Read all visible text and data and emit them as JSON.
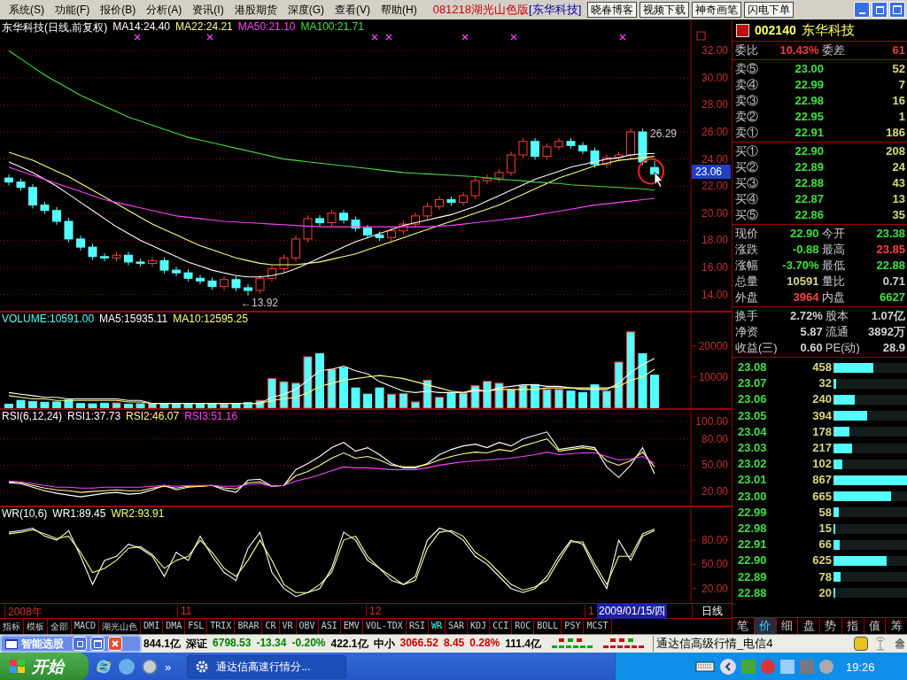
{
  "menu": {
    "items": [
      "系统(S)",
      "功能(F)",
      "报价(B)",
      "分析(A)",
      "资讯(I)",
      "港股期货",
      "深度(G)",
      "查看(V)",
      "帮助(H)"
    ],
    "version": "081218湖光山色版",
    "stock": "[东华科技]",
    "buttons": [
      "晓春博客",
      "视频下载",
      "神奇画笔",
      "闪电下单"
    ]
  },
  "price_panel": {
    "title": "东华科技(日线,前复权)",
    "high_label": "26.29",
    "low_label": "←13.92",
    "cursor_label": "23.06",
    "chart_data": {
      "type": "candlestick",
      "ylim": [
        12.8,
        34.3
      ],
      "grid": true,
      "yticks": [
        {
          "value": 32,
          "label": "32.00"
        },
        {
          "value": 30,
          "label": "30.00"
        },
        {
          "value": 28,
          "label": "28.00"
        },
        {
          "value": 26,
          "label": "26.00"
        },
        {
          "value": 24,
          "label": "24.00"
        },
        {
          "value": 22,
          "label": "22.00"
        },
        {
          "value": 20,
          "label": "20.00"
        },
        {
          "value": 18,
          "label": "18.00"
        },
        {
          "value": 16,
          "label": "16.00"
        },
        {
          "value": 14,
          "label": "14.00"
        }
      ],
      "ohlc": [
        [
          22.6,
          22.85,
          22.05,
          22.3
        ],
        [
          22.3,
          22.55,
          21.65,
          21.9
        ],
        [
          21.9,
          22.15,
          20.35,
          20.6
        ],
        [
          20.6,
          20.85,
          19.95,
          20.2
        ],
        [
          20.2,
          20.45,
          19.15,
          19.4
        ],
        [
          19.4,
          19.65,
          17.85,
          18.1
        ],
        [
          18.1,
          18.35,
          17.25,
          17.5
        ],
        [
          17.5,
          17.75,
          16.55,
          16.8
        ],
        [
          16.8,
          17.05,
          16.45,
          16.7
        ],
        [
          16.7,
          17.15,
          16.45,
          16.9
        ],
        [
          16.9,
          17.15,
          16.15,
          16.4
        ],
        [
          16.4,
          16.65,
          16.05,
          16.3
        ],
        [
          16.3,
          16.75,
          16.05,
          16.5
        ],
        [
          16.5,
          16.75,
          15.55,
          15.8
        ],
        [
          15.8,
          16.05,
          15.35,
          15.6
        ],
        [
          15.6,
          15.85,
          14.95,
          15.2
        ],
        [
          15.2,
          15.45,
          14.75,
          15.0
        ],
        [
          15.0,
          15.25,
          14.35,
          14.6
        ],
        [
          14.6,
          15.35,
          14.35,
          15.1
        ],
        [
          15.1,
          15.35,
          14.25,
          14.5
        ],
        [
          14.5,
          14.75,
          13.92,
          14.3
        ],
        [
          14.3,
          15.45,
          14.05,
          15.2
        ],
        [
          15.2,
          16.15,
          14.95,
          15.9
        ],
        [
          15.9,
          16.95,
          15.65,
          16.7
        ],
        [
          16.7,
          18.35,
          16.45,
          18.1
        ],
        [
          18.1,
          19.85,
          17.85,
          19.6
        ],
        [
          19.6,
          19.85,
          19.05,
          19.3
        ],
        [
          19.3,
          20.25,
          19.05,
          20.0
        ],
        [
          20.0,
          20.25,
          19.25,
          19.5
        ],
        [
          19.5,
          19.75,
          18.65,
          18.9
        ],
        [
          18.9,
          19.15,
          18.15,
          18.4
        ],
        [
          18.4,
          18.65,
          17.95,
          18.2
        ],
        [
          18.2,
          18.95,
          17.95,
          18.7
        ],
        [
          18.7,
          19.45,
          18.45,
          19.2
        ],
        [
          19.2,
          20.05,
          18.95,
          19.8
        ],
        [
          19.8,
          20.75,
          19.55,
          20.5
        ],
        [
          20.5,
          21.25,
          20.25,
          21.0
        ],
        [
          21.0,
          21.25,
          20.55,
          20.8
        ],
        [
          20.8,
          21.55,
          20.55,
          21.3
        ],
        [
          21.3,
          22.65,
          21.05,
          22.4
        ],
        [
          22.4,
          22.85,
          22.15,
          22.6
        ],
        [
          22.6,
          23.25,
          22.35,
          23.0
        ],
        [
          23.0,
          24.55,
          22.75,
          24.3
        ],
        [
          24.3,
          25.55,
          24.05,
          25.3
        ],
        [
          25.3,
          25.55,
          23.95,
          24.2
        ],
        [
          24.2,
          25.15,
          23.95,
          24.9
        ],
        [
          24.9,
          25.55,
          24.65,
          25.3
        ],
        [
          25.3,
          25.55,
          24.75,
          25.0
        ],
        [
          25.0,
          25.25,
          24.35,
          24.6
        ],
        [
          24.6,
          24.85,
          23.35,
          23.6
        ],
        [
          23.6,
          24.35,
          23.35,
          24.1
        ],
        [
          24.1,
          24.55,
          23.85,
          24.3
        ],
        [
          24.3,
          26.29,
          24.05,
          26.0
        ],
        [
          26.0,
          26.25,
          23.55,
          23.78
        ],
        [
          23.38,
          23.85,
          22.88,
          22.9
        ]
      ],
      "series": [
        {
          "name": "MA14:24.40",
          "color": "#ffffff",
          "type": "line",
          "values": [
            23.8,
            23.4,
            23.0,
            22.5,
            22.0,
            21.4,
            20.8,
            20.2,
            19.6,
            19.0,
            18.5,
            18.0,
            17.6,
            17.2,
            16.8,
            16.4,
            16.1,
            15.8,
            15.6,
            15.4,
            15.3,
            15.3,
            15.4,
            15.6,
            15.9,
            16.3,
            16.7,
            17.1,
            17.5,
            17.9,
            18.2,
            18.5,
            18.8,
            19.1,
            19.3,
            19.5,
            19.7,
            19.9,
            20.2,
            20.5,
            20.9,
            21.3,
            21.7,
            22.1,
            22.5,
            22.8,
            23.1,
            23.4,
            23.6,
            23.8,
            24.0,
            24.1,
            24.3,
            24.4,
            24.4
          ]
        },
        {
          "name": "MA22:24.21",
          "color": "#ffff80",
          "type": "line",
          "values": [
            24.5,
            24.2,
            23.9,
            23.5,
            23.1,
            22.7,
            22.2,
            21.7,
            21.2,
            20.7,
            20.2,
            19.7,
            19.2,
            18.8,
            18.4,
            18.0,
            17.6,
            17.3,
            17.0,
            16.7,
            16.5,
            16.3,
            16.2,
            16.2,
            16.2,
            16.3,
            16.4,
            16.6,
            16.8,
            17.0,
            17.3,
            17.6,
            17.9,
            18.2,
            18.5,
            18.8,
            19.1,
            19.4,
            19.7,
            20.0,
            20.3,
            20.6,
            21.0,
            21.4,
            21.8,
            22.2,
            22.6,
            22.9,
            23.2,
            23.5,
            23.7,
            23.9,
            24.0,
            24.1,
            24.2
          ]
        },
        {
          "name": "MA50:21.10",
          "color": "#ff40ff",
          "type": "line",
          "values": [
            23.4,
            23.1,
            22.8,
            22.5,
            22.2,
            21.9,
            21.6,
            21.3,
            21.0,
            20.8,
            20.6,
            20.4,
            20.2,
            20.0,
            19.8,
            19.7,
            19.6,
            19.5,
            19.4,
            19.35,
            19.3,
            19.25,
            19.2,
            19.15,
            19.1,
            19.05,
            19.0,
            19.0,
            19.0,
            19.0,
            19.0,
            19.0,
            19.0,
            19.0,
            19.0,
            19.0,
            19.05,
            19.1,
            19.2,
            19.3,
            19.4,
            19.5,
            19.6,
            19.7,
            19.85,
            20.0,
            20.15,
            20.3,
            20.45,
            20.6,
            20.7,
            20.8,
            20.9,
            21.0,
            21.1
          ]
        },
        {
          "name": "MA100:21.71",
          "color": "#40e040",
          "type": "line",
          "values": [
            32.0,
            31.4,
            30.8,
            30.2,
            29.7,
            29.2,
            28.7,
            28.3,
            27.9,
            27.5,
            27.1,
            26.8,
            26.5,
            26.2,
            25.9,
            25.6,
            25.4,
            25.2,
            25.0,
            24.8,
            24.6,
            24.4,
            24.2,
            24.0,
            23.9,
            23.8,
            23.7,
            23.6,
            23.5,
            23.4,
            23.3,
            23.2,
            23.1,
            23.0,
            22.95,
            22.9,
            22.85,
            22.8,
            22.75,
            22.7,
            22.6,
            22.5,
            22.45,
            22.4,
            22.3,
            22.25,
            22.2,
            22.1,
            22.05,
            22.0,
            21.95,
            21.9,
            21.85,
            21.8,
            21.7
          ]
        }
      ]
    }
  },
  "volume_panel": {
    "chart_data": {
      "type": "bar",
      "ylim": [
        0,
        31000
      ],
      "yticks": [
        20000,
        10000
      ],
      "series": [
        {
          "name": "VOLUME:10591.00",
          "color": "#54ffff",
          "values": [
            1300,
            2500,
            2100,
            1900,
            2000,
            2600,
            1500,
            1400,
            1600,
            1700,
            1300,
            1400,
            1500,
            1300,
            1300,
            1400,
            1300,
            1500,
            1400,
            1300,
            1800,
            2500,
            9500,
            8500,
            8000,
            16500,
            17500,
            12500,
            13000,
            6500,
            4500,
            6500,
            4500,
            4700,
            2000,
            9000,
            3500,
            4800,
            4800,
            7200,
            8600,
            8000,
            6000,
            7300,
            7600,
            6000,
            6000,
            5500,
            5000,
            7500,
            5500,
            14800,
            24500,
            17500,
            10600
          ]
        },
        {
          "name": "MA5:15935.11",
          "color": "#ffffff",
          "type": "line",
          "values": [
            5000,
            4500,
            4000,
            3500,
            3500,
            3000,
            3000,
            3000,
            3000,
            3000,
            2500,
            2500,
            1500,
            1500,
            1500,
            1500,
            1500,
            1500,
            1500,
            1500,
            1500,
            1500,
            3500,
            4500,
            6000,
            9000,
            12000,
            12500,
            13500,
            12000,
            11000,
            8500,
            7000,
            5500,
            5000,
            5500,
            5000,
            5000,
            5000,
            6000,
            5500,
            6500,
            7000,
            7500,
            7500,
            7000,
            7000,
            6500,
            6000,
            6000,
            6000,
            8000,
            11500,
            14000,
            16000
          ]
        },
        {
          "name": "MA10:12595.25",
          "color": "#ffff80",
          "type": "line",
          "values": [
            4000,
            3500,
            3000,
            3000,
            2500,
            2500,
            2500,
            2500,
            2500,
            2500,
            2000,
            2000,
            1500,
            1500,
            1500,
            1500,
            1500,
            1500,
            1500,
            1500,
            1500,
            1500,
            2500,
            3000,
            3500,
            5000,
            7000,
            8000,
            9000,
            9500,
            10000,
            10500,
            10000,
            9500,
            8500,
            7500,
            6500,
            5500,
            5000,
            5500,
            5500,
            6000,
            6000,
            6000,
            6000,
            6500,
            6500,
            6500,
            6500,
            6500,
            6500,
            7000,
            9000,
            10000,
            12500
          ]
        }
      ]
    }
  },
  "rsi_panel": {
    "title": "RSI(6,12,24)",
    "chart_data": {
      "type": "line",
      "ylim": [
        4,
        114
      ],
      "grid": true,
      "yticks": [
        {
          "value": 20,
          "label": "20.00"
        },
        {
          "value": 50,
          "label": "50.00"
        },
        {
          "value": 80,
          "label": "80.00"
        },
        {
          "value": 100,
          "label": "100.00"
        }
      ],
      "series": [
        {
          "name": "RSI1:37.73",
          "color": "#ffffff",
          "values": [
            30,
            29,
            25,
            21,
            18,
            16,
            14,
            16,
            18,
            19,
            17,
            18,
            22,
            27,
            22,
            25,
            26,
            27,
            22,
            19,
            33,
            34,
            26,
            27,
            45,
            52,
            60,
            70,
            76,
            66,
            70,
            62,
            52,
            47,
            47,
            52,
            62,
            68,
            72,
            74,
            70,
            76,
            72,
            80,
            84,
            88,
            68,
            70,
            72,
            70,
            48,
            36,
            50,
            70,
            40
          ]
        },
        {
          "name": "RSI2:46.07",
          "color": "#ffff80",
          "values": [
            31,
            30,
            27,
            24,
            22,
            21,
            19,
            20,
            21,
            22,
            21,
            21,
            24,
            26,
            24,
            26,
            26,
            27,
            24,
            23,
            30,
            31,
            26,
            27,
            38,
            43,
            50,
            58,
            64,
            58,
            60,
            56,
            50,
            48,
            48,
            51,
            56,
            60,
            63,
            65,
            64,
            68,
            66,
            72,
            76,
            80,
            66,
            68,
            70,
            68,
            55,
            50,
            55,
            65,
            48
          ]
        },
        {
          "name": "RSI3:51.16",
          "color": "#ff40ff",
          "values": [
            32,
            31,
            29,
            27,
            25,
            25,
            24,
            24,
            25,
            25,
            25,
            25,
            26,
            27,
            26,
            27,
            27,
            27,
            26,
            26,
            28,
            29,
            26,
            27,
            32,
            35,
            39,
            44,
            48,
            47,
            47,
            46,
            45,
            45,
            45,
            47,
            50,
            52,
            54,
            55,
            56,
            57,
            58,
            60,
            62,
            65,
            62,
            63,
            64,
            64,
            60,
            56,
            57,
            60,
            52
          ]
        }
      ]
    }
  },
  "wr_panel": {
    "title": "WR(10,6)",
    "chart_data": {
      "type": "line",
      "ylim": [
        2,
        122
      ],
      "yticks": [
        {
          "value": 20,
          "label": "20.00"
        },
        {
          "value": 50,
          "label": "50.00"
        },
        {
          "value": 80,
          "label": "80.00"
        }
      ],
      "series": [
        {
          "name": "WR1:89.45",
          "color": "#ffffff",
          "values": [
            90,
            92,
            95,
            85,
            80,
            92,
            60,
            25,
            55,
            60,
            75,
            70,
            60,
            35,
            65,
            55,
            85,
            60,
            40,
            30,
            70,
            90,
            40,
            20,
            10,
            15,
            20,
            45,
            90,
            80,
            55,
            45,
            30,
            25,
            35,
            80,
            95,
            90,
            80,
            60,
            50,
            35,
            20,
            15,
            20,
            35,
            60,
            80,
            75,
            45,
            20,
            80,
            55,
            85,
            92
          ]
        },
        {
          "name": "WR2:93.91",
          "color": "#ffff80",
          "values": [
            88,
            90,
            93,
            88,
            82,
            85,
            65,
            40,
            45,
            55,
            70,
            72,
            62,
            45,
            55,
            60,
            80,
            65,
            45,
            35,
            55,
            80,
            55,
            25,
            15,
            15,
            25,
            40,
            80,
            85,
            60,
            45,
            35,
            25,
            30,
            70,
            90,
            92,
            85,
            65,
            55,
            40,
            25,
            18,
            22,
            30,
            55,
            78,
            78,
            50,
            25,
            60,
            60,
            88,
            94
          ]
        }
      ]
    }
  },
  "date_axis": {
    "labels": [
      "2008年",
      "11",
      "12",
      "1"
    ],
    "cursor_date": "2009/01/15/四",
    "period": "日线"
  },
  "indicator_tabs": [
    {
      "label": "指标",
      "selected": false
    },
    {
      "label": "模板",
      "selected": false
    },
    {
      "label": "全部",
      "selected": false
    },
    {
      "label": "MACD",
      "selected": false
    },
    {
      "label": "湖光山色",
      "selected": false
    },
    {
      "label": "DMI",
      "selected": false
    },
    {
      "label": "DMA",
      "selected": false
    },
    {
      "label": "FSL",
      "selected": false
    },
    {
      "label": "TRIX",
      "selected": false
    },
    {
      "label": "BRAR",
      "selected": false
    },
    {
      "label": "CR",
      "selected": false
    },
    {
      "label": "VR",
      "selected": false
    },
    {
      "label": "OBV",
      "selected": false
    },
    {
      "label": "ASI",
      "selected": false
    },
    {
      "label": "EMV",
      "selected": false
    },
    {
      "label": "VOL-TDX",
      "selected": false
    },
    {
      "label": "RSI",
      "selected": false
    },
    {
      "label": "WR",
      "selected": true
    },
    {
      "label": "SAR",
      "selected": false
    },
    {
      "label": "KDJ",
      "selected": false
    },
    {
      "label": "CCI",
      "selected": false
    },
    {
      "label": "ROC",
      "selected": false
    },
    {
      "label": "BOLL",
      "selected": false
    },
    {
      "label": "PSY",
      "selected": false
    },
    {
      "label": "MCST",
      "selected": false
    }
  ],
  "quote": {
    "code": "002140",
    "name": "东华科技",
    "ratio": [
      {
        "label": "委比",
        "value": "10.43%"
      },
      {
        "label": "委差",
        "value": "61"
      }
    ],
    "sell": [
      {
        "label": "卖⑤",
        "price": "23.00",
        "volume": "52"
      },
      {
        "label": "卖④",
        "price": "22.99",
        "volume": "7"
      },
      {
        "label": "卖③",
        "price": "22.98",
        "volume": "16"
      },
      {
        "label": "卖②",
        "price": "22.95",
        "volume": "1"
      },
      {
        "label": "卖①",
        "price": "22.91",
        "volume": "186"
      }
    ],
    "buy": [
      {
        "label": "买①",
        "price": "22.90",
        "volume": "208"
      },
      {
        "label": "买②",
        "price": "22.89",
        "volume": "24"
      },
      {
        "label": "买③",
        "price": "22.88",
        "volume": "43"
      },
      {
        "label": "买④",
        "price": "22.87",
        "volume": "13"
      },
      {
        "label": "买⑤",
        "price": "22.86",
        "volume": "35"
      }
    ],
    "stats": [
      [
        {
          "label": "现价",
          "value": "22.90",
          "color": "#40e040"
        },
        {
          "label": "今开",
          "value": "23.38",
          "color": "#40e040"
        }
      ],
      [
        {
          "label": "涨跌",
          "value": "-0.88",
          "color": "#40e040"
        },
        {
          "label": "最高",
          "value": "23.85",
          "color": "#ff4040"
        }
      ],
      [
        {
          "label": "涨幅",
          "value": "-3.70%",
          "color": "#40e040"
        },
        {
          "label": "最低",
          "value": "22.88",
          "color": "#40e040"
        }
      ],
      [
        {
          "label": "总量",
          "value": "10591",
          "color": "#d8d880"
        },
        {
          "label": "量比",
          "value": "0.71",
          "color": "#d0d0d0"
        }
      ],
      [
        {
          "label": "外盘",
          "value": "3964",
          "color": "#ff4040"
        },
        {
          "label": "内盘",
          "value": "6627",
          "color": "#40e040"
        }
      ]
    ],
    "fundamentals": [
      [
        {
          "label": "换手",
          "value": "2.72%"
        },
        {
          "label": "股本",
          "value": "1.07亿"
        }
      ],
      [
        {
          "label": "净资",
          "value": "5.87"
        },
        {
          "label": "流通",
          "value": "3892万"
        }
      ],
      [
        {
          "label": "收益(三)",
          "value": "0.60"
        },
        {
          "label": "PE(动)",
          "value": "28.9"
        }
      ]
    ],
    "price_levels": [
      {
        "price": "23.08",
        "volume": "458",
        "level": 0.53
      },
      {
        "price": "23.07",
        "volume": "32",
        "level": 0.04
      },
      {
        "price": "23.06",
        "volume": "240",
        "level": 0.28
      },
      {
        "price": "23.05",
        "volume": "394",
        "level": 0.45
      },
      {
        "price": "23.04",
        "volume": "178",
        "level": 0.21
      },
      {
        "price": "23.03",
        "volume": "217",
        "level": 0.25
      },
      {
        "price": "23.02",
        "volume": "102",
        "level": 0.12
      },
      {
        "price": "23.01",
        "volume": "867",
        "level": 1.0
      },
      {
        "price": "23.00",
        "volume": "665",
        "level": 0.77
      },
      {
        "price": "22.99",
        "volume": "58",
        "level": 0.07
      },
      {
        "price": "22.98",
        "volume": "15",
        "level": 0.02
      },
      {
        "price": "22.91",
        "volume": "66",
        "level": 0.08
      },
      {
        "price": "22.90",
        "volume": "625",
        "level": 0.72
      },
      {
        "price": "22.89",
        "volume": "78",
        "level": 0.09
      },
      {
        "price": "22.88",
        "volume": "20",
        "level": 0.02
      }
    ],
    "tabs": [
      {
        "label": "笔",
        "selected": false
      },
      {
        "label": "价",
        "selected": true
      },
      {
        "label": "细",
        "selected": false
      },
      {
        "label": "盘",
        "selected": false
      },
      {
        "label": "势",
        "selected": false
      },
      {
        "label": "指",
        "selected": false
      },
      {
        "label": "值",
        "selected": false
      },
      {
        "label": "筹",
        "selected": false
      }
    ]
  },
  "floating_toolbar": {
    "title": "智能选股"
  },
  "status_bar": {
    "items": [
      {
        "text": "844.1亿",
        "color": "#000000"
      },
      {
        "text": "深证",
        "color": "#000000"
      },
      {
        "text": "6798.53",
        "color": "#008000"
      },
      {
        "text": "-13.34",
        "color": "#008000"
      },
      {
        "text": "-0.20%",
        "color": "#008000"
      },
      {
        "text": "422.1亿",
        "color": "#000000"
      },
      {
        "text": "中小",
        "color": "#000000"
      },
      {
        "text": "3066.52",
        "color": "#d00000"
      },
      {
        "text": "8.45",
        "color": "#d00000"
      },
      {
        "text": "0.28%",
        "color": "#d00000"
      },
      {
        "text": "111.4亿",
        "color": "#000000"
      }
    ],
    "server": "通达信高级行情_电信4"
  },
  "taskbar": {
    "start": "开始",
    "more": "»",
    "task": "通达信高速行情分...",
    "clock": "19:26"
  }
}
